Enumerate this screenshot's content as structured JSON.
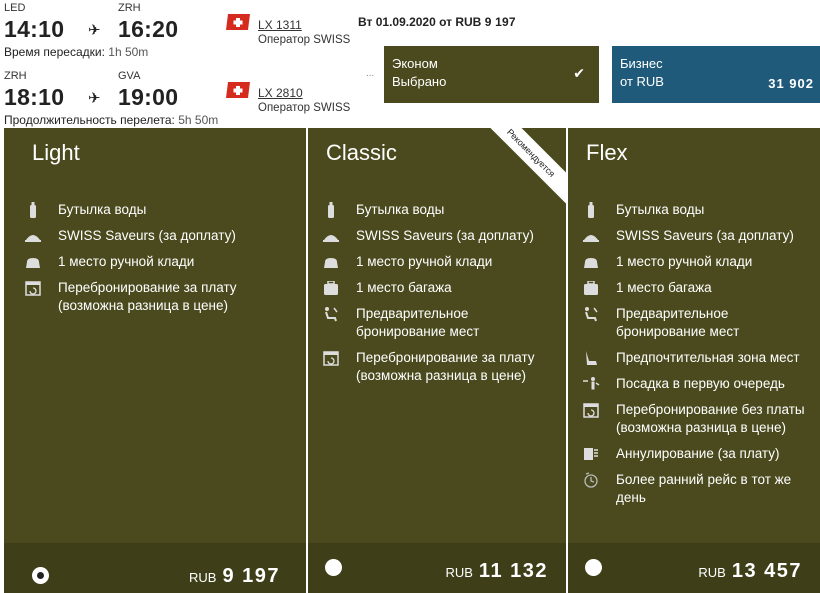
{
  "flights": [
    {
      "from_code": "LED",
      "to_code": "ZRH",
      "dep_time": "14:10",
      "arr_time": "16:20",
      "sub_label": "Время пересадки:",
      "sub_value": "1h 50m",
      "flight_no": "LX 1311",
      "operator_label": "Оператор",
      "operator_value": "SWISS"
    },
    {
      "from_code": "ZRH",
      "to_code": "GVA",
      "dep_time": "18:10",
      "arr_time": "19:00",
      "sub_label": "Продолжительность перелета:",
      "sub_value": "5h 50m",
      "flight_no": "LX 2810",
      "operator_label": "Оператор",
      "operator_value": "SWISS"
    }
  ],
  "date_line": {
    "prefix": "Вт 01.09.2020 от RUB",
    "amount": "9 197"
  },
  "dots": "...",
  "fare_classes": {
    "economy": {
      "name": "Эконом",
      "status": "Выбрано"
    },
    "business": {
      "name": "Бизнес",
      "price_prefix": "от RUB",
      "price": "31 902"
    }
  },
  "columns": {
    "light": {
      "title": "Light",
      "features": [
        {
          "icon": "water-bottle-icon",
          "text": "Бутылка воды"
        },
        {
          "icon": "food-tray-icon",
          "text": "SWISS Saveurs (за доплату)"
        },
        {
          "icon": "hand-baggage-icon",
          "text": "1 место ручной клади"
        },
        {
          "icon": "calendar-change-icon",
          "text": "Перебронирование за плату (возможна разница в цене)"
        }
      ],
      "currency": "RUB",
      "price": "9 197"
    },
    "classic": {
      "title": "Classic",
      "ribbon": "Рекомендуется",
      "features": [
        {
          "icon": "water-bottle-icon",
          "text": "Бутылка воды"
        },
        {
          "icon": "food-tray-icon",
          "text": "SWISS Saveurs (за доплату)"
        },
        {
          "icon": "hand-baggage-icon",
          "text": "1 место ручной клади"
        },
        {
          "icon": "suitcase-icon",
          "text": "1 место багажа"
        },
        {
          "icon": "seat-select-icon",
          "text": "Предварительное бронирование мест"
        },
        {
          "icon": "calendar-change-icon",
          "text": "Перебронирование за плату (возможна разница в цене)"
        }
      ],
      "currency": "RUB",
      "price": "11 132"
    },
    "flex": {
      "title": "Flex",
      "features": [
        {
          "icon": "water-bottle-icon",
          "text": "Бутылка воды"
        },
        {
          "icon": "food-tray-icon",
          "text": "SWISS Saveurs (за доплату)"
        },
        {
          "icon": "hand-baggage-icon",
          "text": "1 место ручной клади"
        },
        {
          "icon": "suitcase-icon",
          "text": "1 место багажа"
        },
        {
          "icon": "seat-select-icon",
          "text": "Предварительное бронирование мест"
        },
        {
          "icon": "preferred-seat-icon",
          "text": "Предпочтительная зона мест"
        },
        {
          "icon": "priority-boarding-icon",
          "text": "Посадка в первую очередь"
        },
        {
          "icon": "calendar-change-icon",
          "text": "Перебронирование без платы (возможна разница в цене)"
        },
        {
          "icon": "cancel-ticket-icon",
          "text": "Аннулирование (за плату)"
        },
        {
          "icon": "early-flight-icon",
          "text": "Более ранний рейс в тот же день"
        }
      ],
      "currency": "RUB",
      "price": "13 457"
    }
  },
  "colors": {
    "olive": "#4a4a1e",
    "olive_dark": "#3e3e18",
    "business_blue": "#1f5a7a",
    "swiss_red": "#d52b1e"
  }
}
